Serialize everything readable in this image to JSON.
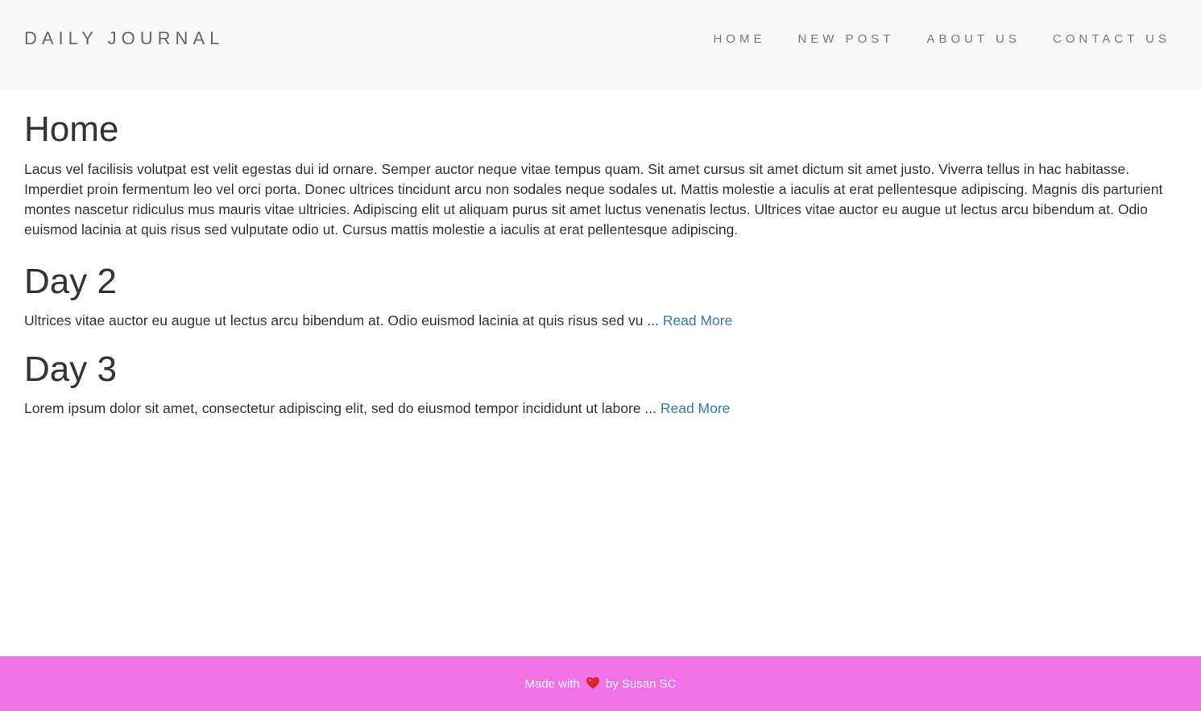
{
  "header": {
    "brand": "DAILY JOURNAL",
    "nav": [
      {
        "label": "HOME"
      },
      {
        "label": "NEW POST"
      },
      {
        "label": "ABOUT US"
      },
      {
        "label": "CONTACT US"
      }
    ]
  },
  "home": {
    "title": "Home",
    "intro": "Lacus vel facilisis volutpat est velit egestas dui id ornare. Semper auctor neque vitae tempus quam. Sit amet cursus sit amet dictum sit amet justo. Viverra tellus in hac habitasse. Imperdiet proin fermentum leo vel orci porta. Donec ultrices tincidunt arcu non sodales neque sodales ut. Mattis molestie a iaculis at erat pellentesque adipiscing. Magnis dis parturient montes nascetur ridiculus mus mauris vitae ultricies. Adipiscing elit ut aliquam purus sit amet luctus venenatis lectus. Ultrices vitae auctor eu augue ut lectus arcu bibendum at. Odio euismod lacinia at quis risus sed vulputate odio ut. Cursus mattis molestie a iaculis at erat pellentesque adipiscing."
  },
  "posts": [
    {
      "title": "Day 2",
      "excerpt": "Ultrices vitae auctor eu augue ut lectus arcu bibendum at. Odio euismod lacinia at quis risus sed vu ... ",
      "read_more": "Read More"
    },
    {
      "title": "Day 3",
      "excerpt": "Lorem ipsum dolor sit amet, consectetur adipiscing elit, sed do eiusmod tempor incididunt ut labore ... ",
      "read_more": "Read More"
    }
  ],
  "footer": {
    "prefix": "Made with",
    "icon": "heart-icon",
    "suffix": "by Susan SC"
  },
  "colors": {
    "navbar_bg": "#f8f8f8",
    "link": "#337ab7",
    "footer_bg": "#f072e6",
    "heart": "#e8202a"
  }
}
